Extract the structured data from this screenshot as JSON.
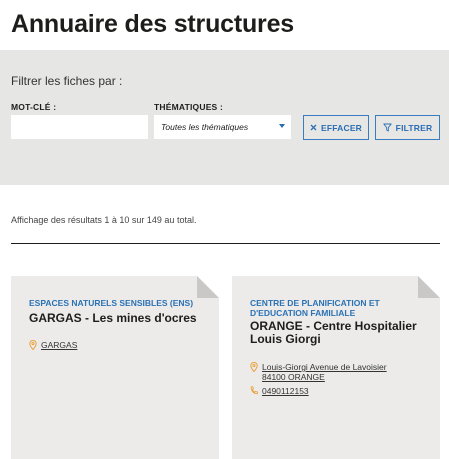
{
  "page": {
    "title": "Annuaire des structures"
  },
  "filters": {
    "intro": "Filtrer les fiches par :",
    "keyword_label": "MOT-CLÉ :",
    "keyword_value": "",
    "theme_label": "THÉMATIQUES :",
    "theme_selected": "Toutes les thématiques",
    "clear_label": "EFFACER",
    "filter_label": "FILTRER"
  },
  "results": {
    "summary": "Affichage des résultats 1 à 10 sur 149 au total."
  },
  "cards": [
    {
      "category": "ESPACES NATURELS SENSIBLES (ENS)",
      "title": "GARGAS - Les mines d'ocres",
      "location": "GARGAS"
    },
    {
      "category_line1": "CENTRE DE PLANIFICATION ET",
      "category_line2": "D'EDUCATION FAMILIALE",
      "title_line1": "ORANGE - Centre Hospitalier",
      "title_line2": "Louis Giorgi",
      "address_line1": "Louis-Giorgi Avenue de Lavoisier",
      "address_line2": "84100 ORANGE",
      "phone": "0490112153"
    }
  ],
  "colors": {
    "accent": "#2a72b5",
    "icon": "#e8a33c",
    "panel": "#e6e6e5",
    "card": "#ecebea"
  }
}
